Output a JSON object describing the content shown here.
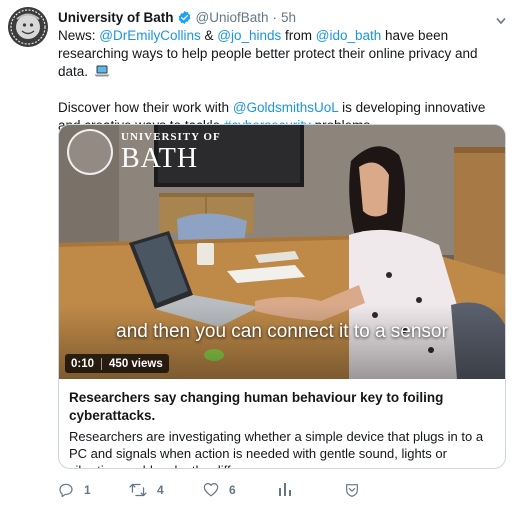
{
  "tweet": {
    "author_name": "University of Bath",
    "author_handle": "@UniofBath",
    "separator": "·",
    "time": "5h",
    "paragraph1": {
      "p1": "News: ",
      "m1": "@DrEmilyCollins",
      "p2": " & ",
      "m2": "@jo_hinds",
      "p3": " from ",
      "m3": "@ido_bath",
      "p4": " have been researching ways to help people better protect their online privacy and data. "
    },
    "paragraph2": {
      "p1": "Discover how their work with ",
      "m1": "@GoldsmithsUoL",
      "p2": " is developing innovative and creative ways to tackle ",
      "h1": "#cybersecurity",
      "p3": " problems."
    }
  },
  "video": {
    "watermark_top": "UNIVERSITY OF",
    "watermark_big": "BATH",
    "subtitle": "and then you can connect it to a sensor",
    "duration": "0:10",
    "views": "450 views"
  },
  "card": {
    "title": "Researchers say changing human behaviour key to foiling cyberattacks.",
    "description": "Researchers are investigating whether a simple device that plugs in to a PC and signals when action is needed with gentle sound, lights or vibration could make the difference."
  },
  "actions": {
    "reply_count": "1",
    "retweet_count": "4",
    "like_count": "6"
  },
  "icons": {
    "verified": "verified-badge-icon",
    "caret": "chevron-down-icon",
    "reply": "reply-icon",
    "retweet": "retweet-icon",
    "like": "heart-icon",
    "analytics": "analytics-icon",
    "dm": "direct-message-icon"
  },
  "colors": {
    "link": "#1b95e0",
    "muted": "#657786",
    "verified": "#1da1f2"
  }
}
